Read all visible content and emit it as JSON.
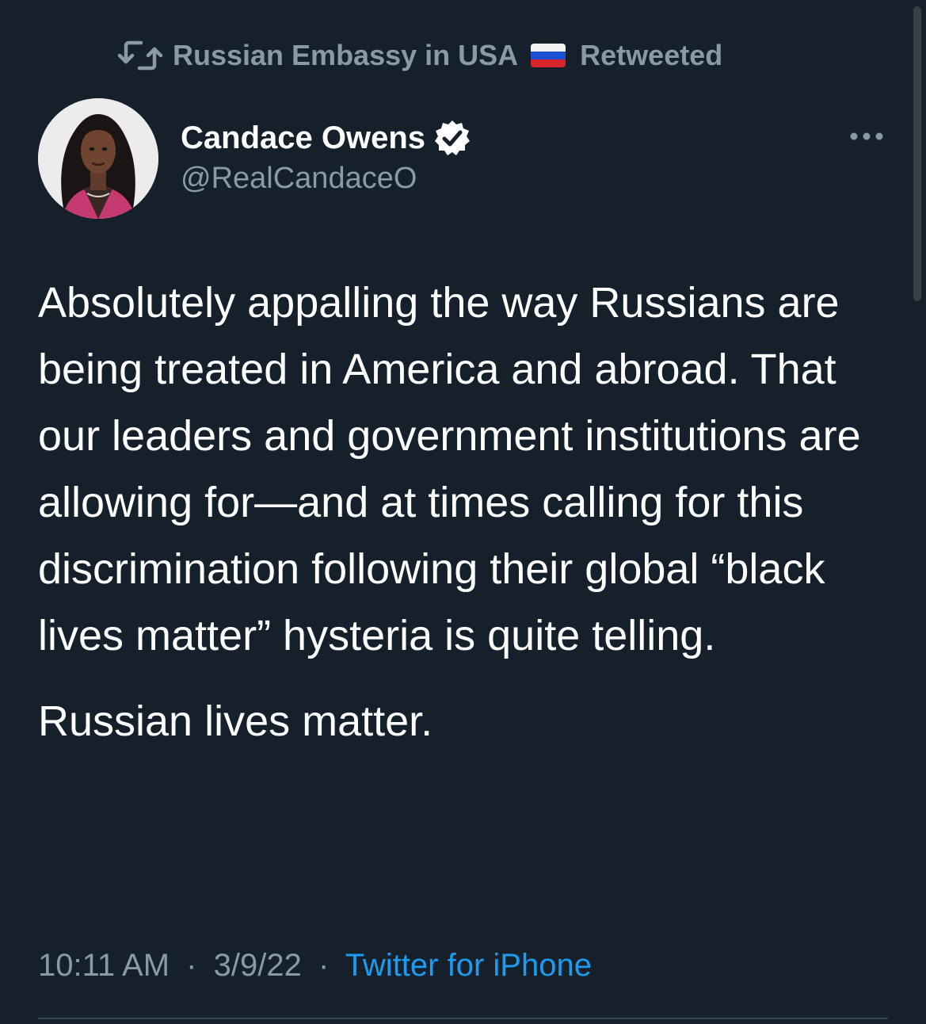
{
  "retweet": {
    "retweeter": "Russian Embassy in USA",
    "action": "Retweeted",
    "icon": "retweet-icon",
    "flag": "russia-flag"
  },
  "author": {
    "display_name": "Candace Owens",
    "handle": "@RealCandaceO",
    "verified": true,
    "verified_icon": "verified-badge-icon"
  },
  "tweet": {
    "paragraphs": [
      "Absolutely appalling the way Russians are being treated in America and abroad. That our leaders and government institutions are allowing for—and at times calling for this discrimination following their global “black lives matter” hysteria is quite telling.",
      "Russian lives matter."
    ]
  },
  "meta": {
    "time": "10:11 AM",
    "date": "3/9/22",
    "separator": "·",
    "source": "Twitter for iPhone"
  },
  "colors": {
    "background": "#15202b",
    "primary_text": "#ffffff",
    "secondary_text": "#8b98a5",
    "link": "#1d9bf0",
    "divider": "#38444d"
  }
}
